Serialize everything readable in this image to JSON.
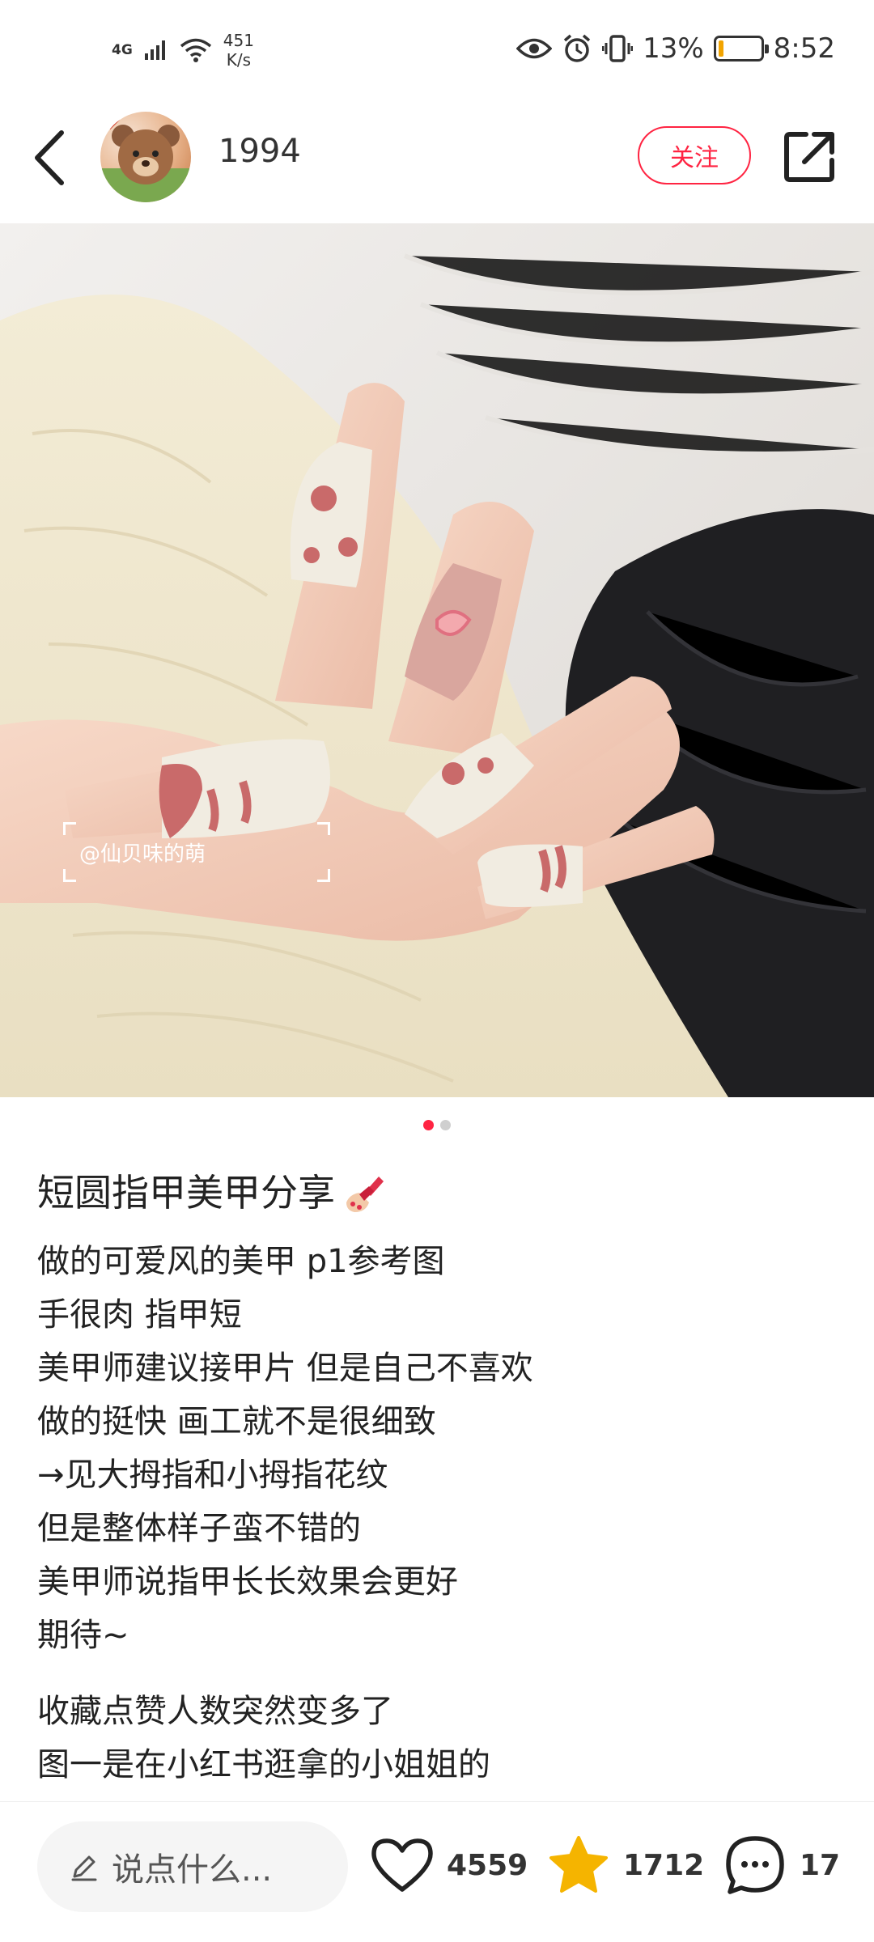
{
  "status_bar": {
    "network": "4G",
    "speed_value": "451",
    "speed_unit": "K/s",
    "battery": "13%",
    "battery_level": 0.13,
    "time": "8:52"
  },
  "header": {
    "author_name": "1994",
    "follow_label": "关注"
  },
  "photo": {
    "watermark": "@仙贝味的萌",
    "page_count": 2,
    "current_page": 1
  },
  "post": {
    "title": "短圆指甲美甲分享",
    "body": [
      "做的可爱风的美甲 p1参考图",
      "手很肉 指甲短",
      "美甲师建议接甲片 但是自己不喜欢",
      "做的挺快 画工就不是很细致",
      "→见大拇指和小拇指花纹",
      "但是整体样子蛮不错的",
      "美甲师说指甲长长效果会更好",
      "期待~"
    ],
    "body_2": [
      "收藏点赞人数突然变多了",
      "图一是在小红书逛拿的小姐姐的"
    ]
  },
  "bottom_bar": {
    "comment_placeholder": "说点什么...",
    "likes": "4559",
    "collects": "1712",
    "comments": "17"
  },
  "colors": {
    "accent": "#ff2442",
    "star": "#f5b400"
  }
}
